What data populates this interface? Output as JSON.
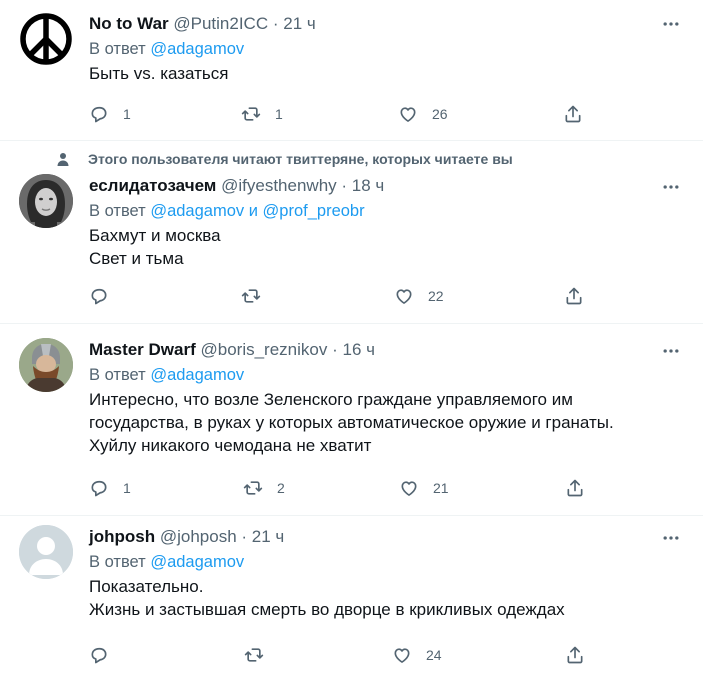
{
  "tweets": [
    {
      "name": "No to War",
      "handle": "@Putin2ICC",
      "time": "21 ч",
      "reply_prefix": "В ответ",
      "reply_to": "@adagamov",
      "reply_and": "",
      "reply_to2": "",
      "lines": [
        "Быть vs. казаться"
      ],
      "replies": "1",
      "retweets": "1",
      "likes": "26",
      "avatar": "peace-sign"
    },
    {
      "social_context": "Этого пользователя читают твиттеряне, которых читаете вы",
      "name": "еслидатозачем",
      "handle": "@ifyesthenwhy",
      "time": "18 ч",
      "reply_prefix": "В ответ",
      "reply_to": "@adagamov",
      "reply_and": "и",
      "reply_to2": "@prof_preobr",
      "lines": [
        "Бахмут и москва",
        "Свет и тьма"
      ],
      "replies": "",
      "retweets": "",
      "likes": "22",
      "avatar": "face-photo"
    },
    {
      "name": "Master Dwarf",
      "handle": "@boris_reznikov",
      "time": "16 ч",
      "reply_prefix": "В ответ",
      "reply_to": "@adagamov",
      "reply_and": "",
      "reply_to2": "",
      "lines": [
        "Интересно,  что возле Зеленского граждане управляемого им",
        "государства, в руках у которых автоматическое оружие и гранаты.",
        "Хуйлу никакого чемодана не хватит"
      ],
      "replies": "1",
      "retweets": "2",
      "likes": "21",
      "avatar": "dwarf-photo"
    },
    {
      "name": "johposh",
      "handle": "@johposh",
      "time": "21 ч",
      "reply_prefix": "В ответ",
      "reply_to": "@adagamov",
      "reply_and": "",
      "reply_to2": "",
      "lines": [
        "Показательно.",
        "Жизнь и застывшая смерть во дворце в крикливых одеждах"
      ],
      "replies": "",
      "retweets": "",
      "likes": "24",
      "avatar": "default-avatar"
    }
  ],
  "colors": {
    "link": "#1d9bf0",
    "secondary": "#536471",
    "text": "#0f1419",
    "divider": "#eff3f4"
  }
}
